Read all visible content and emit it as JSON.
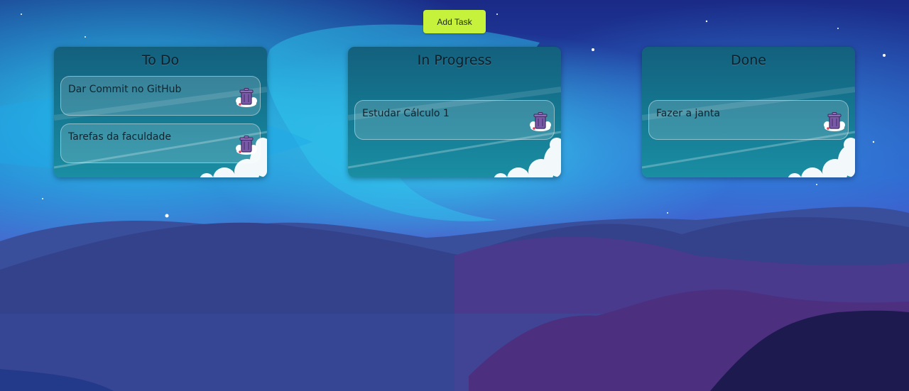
{
  "toolbar": {
    "add_label": "Add Task"
  },
  "columns": [
    {
      "title": "To Do",
      "tasks": [
        {
          "label": "Dar Commit no GitHub"
        },
        {
          "label": "Tarefas da faculdade"
        }
      ]
    },
    {
      "title": "In Progress",
      "tasks": [
        {
          "label": "Estudar Cálculo 1"
        }
      ]
    },
    {
      "title": "Done",
      "tasks": [
        {
          "label": "Fazer a janta"
        }
      ]
    }
  ],
  "colors": {
    "add_button": "#c7f23b",
    "column_bg": "#157a93",
    "sky_dark": "#1b2f8c",
    "aurora": "#22d3ee",
    "mountains": "#2e3f7e"
  },
  "icons": {
    "delete": "trash-can-icon"
  }
}
